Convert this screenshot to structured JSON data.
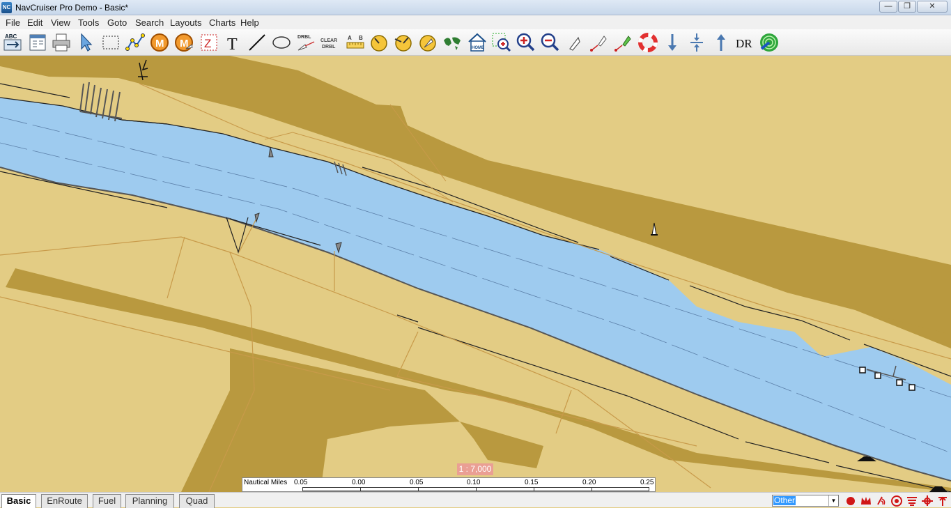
{
  "window": {
    "title": "NavCruiser Pro Demo - Basic*",
    "app_icon_text": "NC",
    "controls": {
      "minimize": "—",
      "maximize": "❐",
      "close": "✕"
    }
  },
  "menu": [
    "File",
    "Edit",
    "View",
    "Tools",
    "Goto",
    "Search",
    "Layouts",
    "Charts",
    "Help"
  ],
  "toolbar": {
    "abc_label": "ABC",
    "m_label": "M",
    "z_label": "Z",
    "text_label": "T",
    "drbl_label": "DRBL",
    "clear_drbl_label": [
      "CLEAR",
      "DRBL"
    ],
    "ab_label": [
      "A",
      "B"
    ],
    "home_label": "HOME",
    "dr_label": "DR"
  },
  "chart": {
    "scale": "1 : 7,000",
    "scalebar": {
      "unit": "Nautical Miles",
      "ticks": [
        "0.05",
        "0.00",
        "0.05",
        "0.10",
        "0.15",
        "0.20",
        "0.25"
      ]
    },
    "colors": {
      "land": "#e3cc84",
      "built_up": "#b9993f",
      "water": "#9ecbef",
      "road": "#c89a4a"
    }
  },
  "tabs": [
    {
      "label": "Basic",
      "active": true
    },
    {
      "label": "EnRoute",
      "active": false
    },
    {
      "label": "Fuel",
      "active": false
    },
    {
      "label": "Planning",
      "active": false
    },
    {
      "label": "Quad",
      "active": false
    }
  ],
  "status": {
    "layer_select": "Other"
  }
}
